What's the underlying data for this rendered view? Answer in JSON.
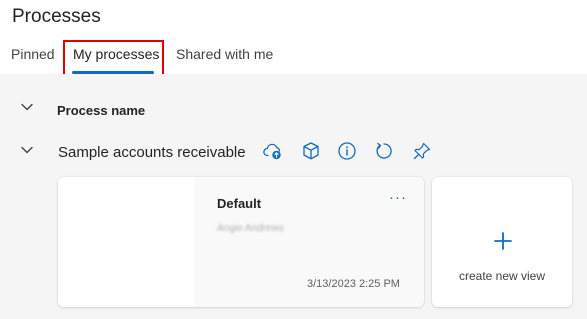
{
  "page": {
    "title": "Processes"
  },
  "tabs": [
    {
      "label": "Pinned"
    },
    {
      "label": "My processes",
      "selected": true
    },
    {
      "label": "Shared with me"
    }
  ],
  "group": {
    "label": "Process name"
  },
  "process": {
    "name": "Sample accounts receivable",
    "actions": [
      "cloud-upload-icon",
      "cube-icon",
      "info-icon",
      "refresh-icon",
      "pin-icon"
    ]
  },
  "view_card": {
    "title": "Default",
    "more_label": "···",
    "owner": "Angie Andrews",
    "date": "3/13/2023 2:25 PM"
  },
  "new_view": {
    "label": "create new view",
    "icon": "+"
  },
  "colors": {
    "accent": "#0f6cbd",
    "highlight": "#e00000",
    "background": "#f5f5f5"
  }
}
